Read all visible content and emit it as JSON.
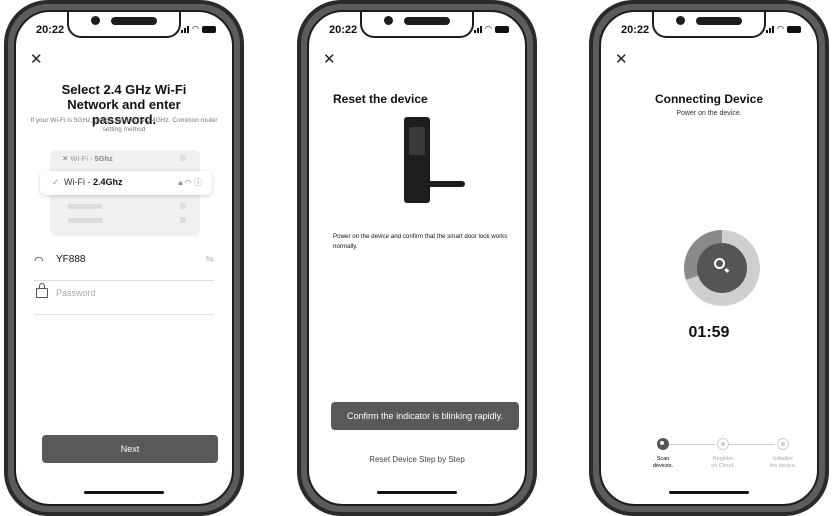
{
  "status_bar": {
    "time": "20:22"
  },
  "screen1": {
    "title": "Select 2.4 GHz Wi-Fi Network and enter password.",
    "subtitle": "If your Wi-Fi is 5GHz, please set it to be 2.4GHz. Common router setting method",
    "network_5g": {
      "prefix": "Wi-Fi - ",
      "band": "5Ghz"
    },
    "network_24g": {
      "prefix": "Wi-Fi - ",
      "band": "2.4Ghz"
    },
    "ssid": "YF888",
    "password_placeholder": "Password",
    "next_button": "Next"
  },
  "screen2": {
    "title": "Reset the device",
    "description": "Power on the device and confirm that the smart door lock works normally.",
    "confirm_button": "Confirm the indicator is blinking rapidly.",
    "steps_link": "Reset Device Step by Step"
  },
  "screen3": {
    "title": "Connecting Device",
    "subtitle": "Power on the device.",
    "timer": "01:59",
    "progress_fraction": 0.3,
    "steps": [
      {
        "line1": "Scan",
        "line2": "devices.",
        "state": "active"
      },
      {
        "line1": "Register",
        "line2": "on Cloud.",
        "state": "pending"
      },
      {
        "line1": "Initialize",
        "line2": "the device.",
        "state": "pending"
      }
    ]
  },
  "colors": {
    "button_dark": "#5a5858",
    "dial_track": "#cfcfcf",
    "dial_progress": "#8a8a8a",
    "dial_center": "#555555",
    "step_active": "#555555",
    "step_inactive": "#cfcfcf"
  }
}
